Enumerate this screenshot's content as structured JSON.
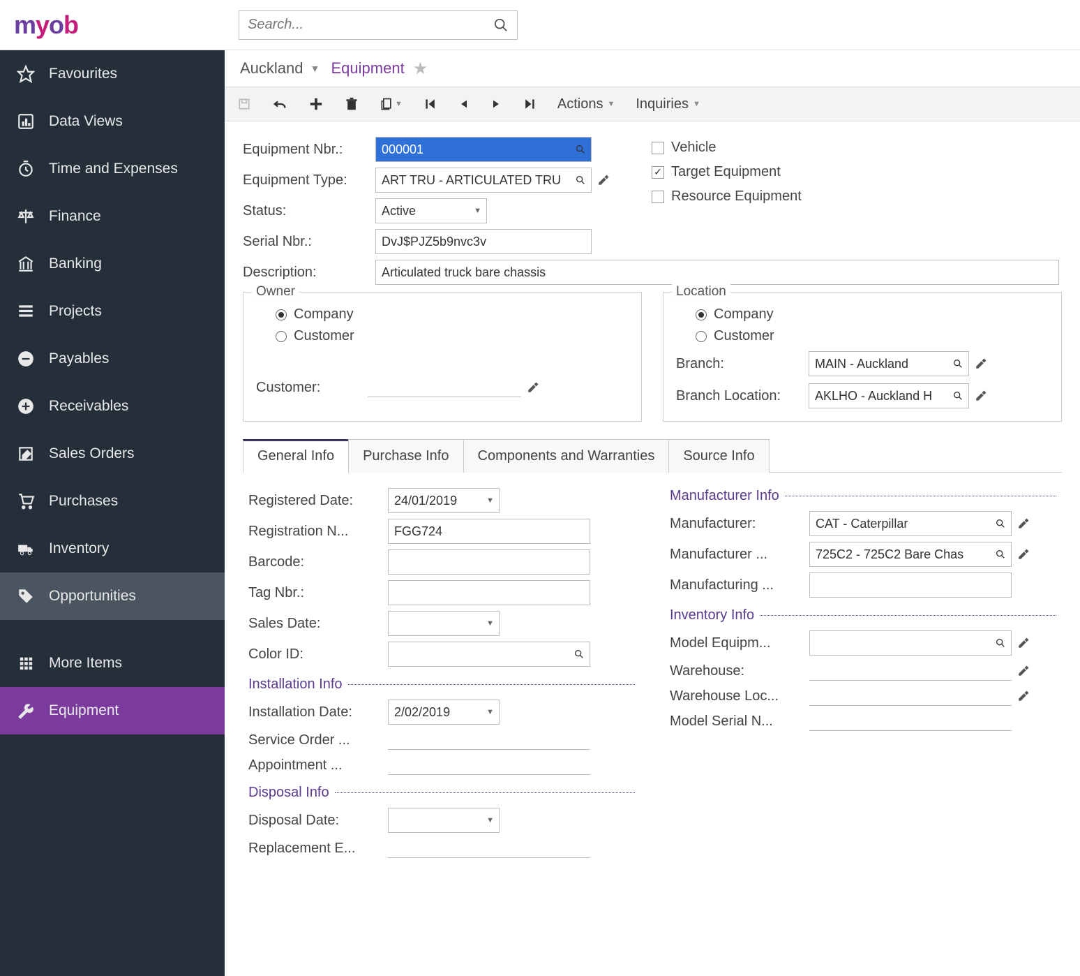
{
  "header": {
    "search_placeholder": "Search..."
  },
  "sidebar": {
    "items": [
      {
        "label": "Favourites"
      },
      {
        "label": "Data Views"
      },
      {
        "label": "Time and Expenses"
      },
      {
        "label": "Finance"
      },
      {
        "label": "Banking"
      },
      {
        "label": "Projects"
      },
      {
        "label": "Payables"
      },
      {
        "label": "Receivables"
      },
      {
        "label": "Sales Orders"
      },
      {
        "label": "Purchases"
      },
      {
        "label": "Inventory"
      },
      {
        "label": "Opportunities"
      },
      {
        "label": "More Items"
      },
      {
        "label": "Equipment"
      }
    ]
  },
  "breadcrumb": {
    "company": "Auckland",
    "page": "Equipment"
  },
  "toolbar": {
    "actions": "Actions",
    "inquiries": "Inquiries"
  },
  "form": {
    "labels": {
      "equipment_nbr": "Equipment Nbr.:",
      "equipment_type": "Equipment Type:",
      "status": "Status:",
      "serial_nbr": "Serial Nbr.:",
      "description": "Description:"
    },
    "values": {
      "equipment_nbr": "000001",
      "equipment_type": "ART TRU - ARTICULATED TRU",
      "status": "Active",
      "serial_nbr": "DvJ$PJZ5b9nvc3v",
      "description": "Articulated truck bare chassis"
    },
    "checks": {
      "vehicle": "Vehicle",
      "target": "Target Equipment",
      "resource": "Resource Equipment"
    },
    "owner": {
      "legend": "Owner",
      "company": "Company",
      "customer": "Customer",
      "customer_label": "Customer:"
    },
    "location": {
      "legend": "Location",
      "company": "Company",
      "customer": "Customer",
      "branch_label": "Branch:",
      "branch_value": "MAIN - Auckland",
      "branch_loc_label": "Branch Location:",
      "branch_loc_value": "AKLHO - Auckland H"
    }
  },
  "tabs": {
    "general": "General Info",
    "purchase": "Purchase Info",
    "components": "Components and Warranties",
    "source": "Source Info"
  },
  "general_info": {
    "labels": {
      "registered_date": "Registered Date:",
      "registration_n": "Registration N...",
      "barcode": "Barcode:",
      "tag_nbr": "Tag Nbr.:",
      "sales_date": "Sales Date:",
      "color_id": "Color ID:",
      "installation_section": "Installation Info",
      "installation_date": "Installation Date:",
      "service_order": "Service Order ...",
      "appointment": "Appointment ...",
      "disposal_section": "Disposal Info",
      "disposal_date": "Disposal Date:",
      "replacement": "Replacement E...",
      "manufacturer_section": "Manufacturer Info",
      "manufacturer": "Manufacturer:",
      "manufacturer_m": "Manufacturer ...",
      "manufacturing": "Manufacturing ...",
      "inventory_section": "Inventory Info",
      "model_equipm": "Model Equipm...",
      "warehouse": "Warehouse:",
      "warehouse_loc": "Warehouse Loc...",
      "model_serial": "Model Serial N..."
    },
    "values": {
      "registered_date": "24/01/2019",
      "registration_n": "FGG724",
      "barcode": "",
      "tag_nbr": "",
      "sales_date": "",
      "color_id": "",
      "installation_date": "2/02/2019",
      "service_order": "",
      "appointment": "",
      "disposal_date": "",
      "replacement": "",
      "manufacturer": "CAT - Caterpillar",
      "manufacturer_m": "725C2 - 725C2 Bare Chas",
      "manufacturing": "",
      "model_equipm": "",
      "warehouse": "",
      "warehouse_loc": "",
      "model_serial": ""
    }
  }
}
